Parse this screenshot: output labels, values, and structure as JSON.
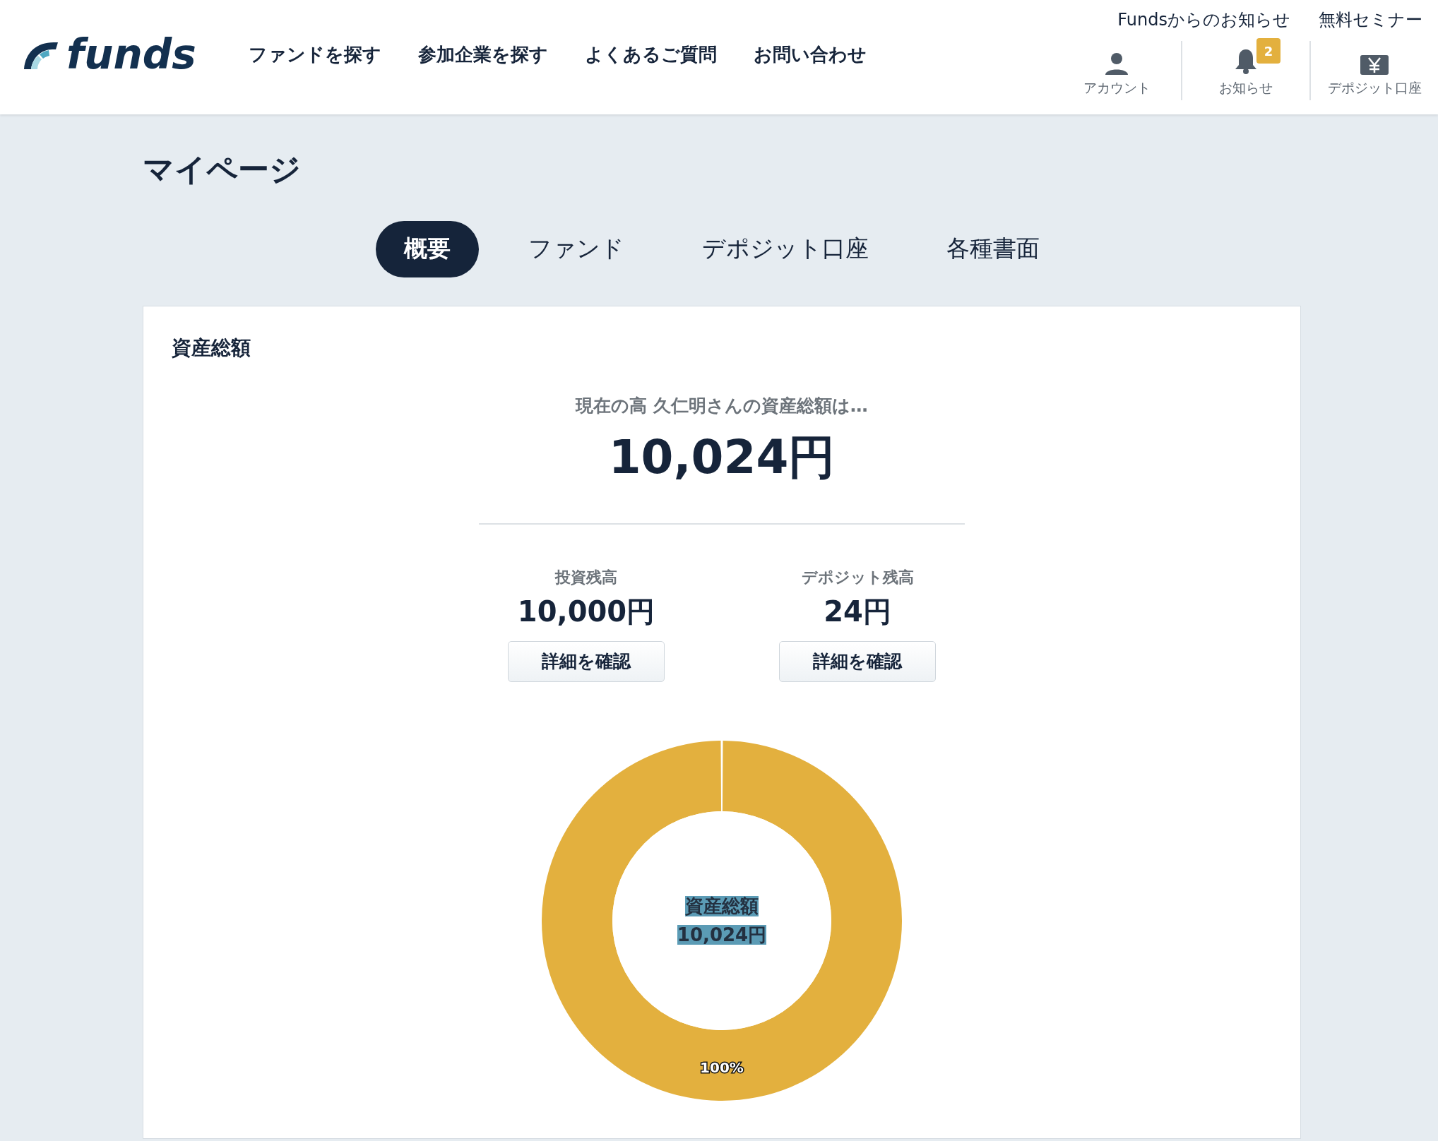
{
  "header": {
    "logo": "funds",
    "nav": [
      "ファンドを探す",
      "参加企業を探す",
      "よくあるご質問",
      "お問い合わせ"
    ],
    "top_links": [
      "Fundsからのお知らせ",
      "無料セミナー"
    ],
    "icons": [
      {
        "kind": "account",
        "label": "アカウント"
      },
      {
        "kind": "bell",
        "label": "お知らせ",
        "badge": "2"
      },
      {
        "kind": "yen",
        "label": "デポジット口座"
      }
    ]
  },
  "page_title": "マイページ",
  "tabs": [
    {
      "label": "概要",
      "selected": true
    },
    {
      "label": "ファンド",
      "selected": false
    },
    {
      "label": "デポジット口座",
      "selected": false
    },
    {
      "label": "各種書面",
      "selected": false
    }
  ],
  "card": {
    "title": "資産総額",
    "intro": "現在の高 久仁明さんの資産総額は…",
    "total": "10,024円",
    "balances": [
      {
        "label": "投資残高",
        "value": "10,000円",
        "button": "詳細を確認"
      },
      {
        "label": "デポジット残高",
        "value": "24円",
        "button": "詳細を確認"
      }
    ],
    "chart": {
      "center_label": "資産総額",
      "center_value": "10,024円",
      "chart_data": {
        "type": "donut",
        "values": [
          100
        ],
        "data_labels": true,
        "value_labels": [
          "100%"
        ]
      }
    }
  }
}
